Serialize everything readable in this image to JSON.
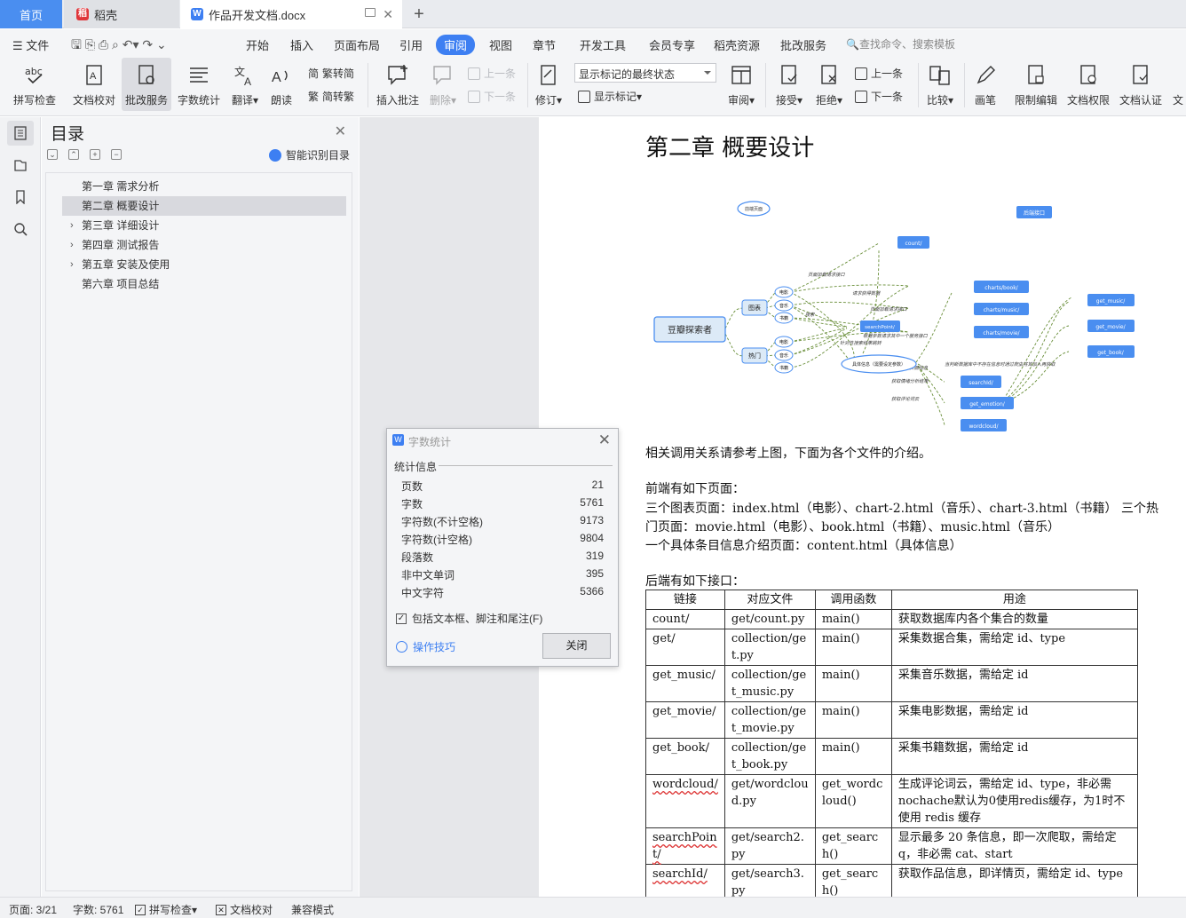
{
  "tabs": {
    "home": "首页",
    "daoke": "稻壳",
    "document": "作品开发文档.docx"
  },
  "menu": {
    "file": "文件",
    "items": [
      "开始",
      "插入",
      "页面布局",
      "引用",
      "审阅",
      "视图",
      "章节",
      "开发工具",
      "会员专享",
      "稻壳资源",
      "批改服务"
    ],
    "search_placeholder": "查找命令、搜索模板"
  },
  "toolbar": {
    "spell_check": "拼写检查",
    "doc_proofread": "文档校对",
    "correction_service": "批改服务",
    "word_count": "字数统计",
    "translate": "翻译",
    "read_aloud": "朗读",
    "trad_to_simp": "繁转简",
    "simp_to_trad": "简转繁",
    "insert_comment": "插入批注",
    "delete": "删除",
    "prev_item": "上一条",
    "next_item": "下一条",
    "revise": "修订",
    "markup_select": "显示标记的最终状态",
    "show_markup": "显示标记",
    "review": "审阅",
    "accept": "接受",
    "reject": "拒绝",
    "prev_change": "上一条",
    "next_change": "下一条",
    "compare": "比较",
    "pen": "画笔",
    "restrict_edit": "限制编辑",
    "doc_permission": "文档权限",
    "doc_certify": "文档认证",
    "more": "文"
  },
  "outline": {
    "title": "目录",
    "smart": "智能识别目录",
    "items": [
      {
        "label": "第一章 需求分析",
        "expandable": false,
        "selected": false
      },
      {
        "label": "第二章 概要设计",
        "expandable": false,
        "selected": true
      },
      {
        "label": "第三章 详细设计",
        "expandable": true,
        "selected": false
      },
      {
        "label": "第四章 测试报告",
        "expandable": true,
        "selected": false
      },
      {
        "label": "第五章 安装及使用",
        "expandable": true,
        "selected": false
      },
      {
        "label": "第六章 项目总结",
        "expandable": false,
        "selected": false
      }
    ]
  },
  "document": {
    "heading": "第二章 概要设计",
    "diagram": {
      "frontend": "前端页面",
      "backend": "后端接口",
      "root": "豆瓣探索者",
      "chart": "图表",
      "hot": "热门",
      "movie": "电影",
      "music": "音乐",
      "book": "书籍",
      "count": "count/",
      "charts_book": "charts/book/",
      "charts_music": "charts/music/",
      "charts_movie": "charts/movie/",
      "searchpoint": "searchPoint/",
      "detail": "具体信息（需要设定参数）",
      "searchid": "searchId/",
      "get_emotion": "get_emotion/",
      "wordcloud": "wordcloud/",
      "get_music": "get_music/",
      "get_movie": "get_movie/",
      "get_book": "get_book/",
      "edge_notes": [
        "页面加载请求接口",
        "请求获得数据",
        "页面加载请求接口",
        "根据参数请求其中一个服务接口",
        "搜索",
        "针对性搜索结果跳转",
        "获取页面信息",
        "获取情绪分析结果",
        "获取评论词云",
        "当判断数据库中不存在信息时通过爬虫将其加入再获取"
      ]
    },
    "para1": "相关调用关系请参考上图，下面为各个文件的介绍。",
    "para2": "前端有如下页面：",
    "para3": "三个图表页面：index.html（电影）、chart-2.html（音乐）、chart-3.html（书籍） 三个热",
    "para4": "门页面：movie.html（电影）、book.html（书籍）、music.html（音乐）",
    "para5": "一个具体条目信息介绍页面：content.html（具体信息）",
    "para6": "后端有如下接口：",
    "table": {
      "headers": [
        "链接",
        "对应文件",
        "调用函数",
        "用途"
      ],
      "rows": [
        [
          "count/",
          "get/count.py",
          "main()",
          "获取数据库内各个集合的数量"
        ],
        [
          "get/",
          "collection/get.py",
          "main()",
          "采集数据合集，需给定 id、type"
        ],
        [
          "get_music/",
          "collection/get_music.py",
          "main()",
          "采集音乐数据，需给定 id"
        ],
        [
          "get_movie/",
          "collection/get_movie.py",
          "main()",
          "采集电影数据，需给定 id"
        ],
        [
          "get_book/",
          "collection/get_book.py",
          "main()",
          "采集书籍数据，需给定 id"
        ],
        [
          "wordcloud/",
          "get/wordcloud.py",
          "get_wordcloud()",
          "生成评论词云，需给定 id、type，非必需nochache默认为0使用redis缓存，为1时不使用 redis 缓存"
        ],
        [
          "searchPoint/",
          "get/search2.py",
          "get_search()",
          "显示最多 20 条信息，即一次爬取，需给定 q，非必需 cat、start"
        ],
        [
          "searchId/",
          "get/search3.py",
          "get_search()",
          "获取作品信息，即详情页，需给定 id、type"
        ]
      ]
    }
  },
  "dialog": {
    "title": "字数统计",
    "section": "统计信息",
    "stats": [
      {
        "label": "页数",
        "value": "21"
      },
      {
        "label": "字数",
        "value": "5761"
      },
      {
        "label": "字符数(不计空格)",
        "value": "9173"
      },
      {
        "label": "字符数(计空格)",
        "value": "9804"
      },
      {
        "label": "段落数",
        "value": "319"
      },
      {
        "label": "非中文单词",
        "value": "395"
      },
      {
        "label": "中文字符",
        "value": "5366"
      }
    ],
    "include": "包括文本框、脚注和尾注(F)",
    "tips": "操作技巧",
    "close": "关闭"
  },
  "status": {
    "page": "页面: 3/21",
    "words": "字数: 5761",
    "spell": "拼写检查",
    "proof": "文档校对",
    "compat": "兼容模式"
  },
  "colors": {
    "accent": "#3d7ff2",
    "node_fill": "#4a8ef0",
    "node_text": "#ffffff",
    "edge": "#6a8f3a"
  }
}
